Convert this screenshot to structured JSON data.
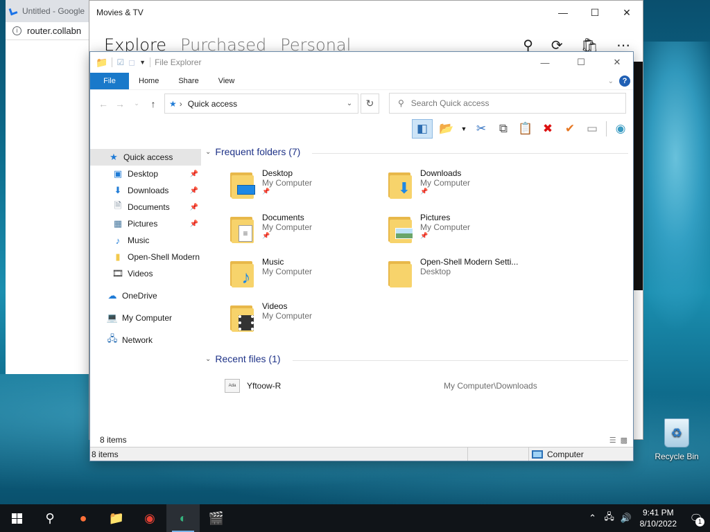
{
  "browser": {
    "tab_title": "Untitled - Google",
    "address": "router.collabn"
  },
  "movies_app": {
    "title": "Movies & TV",
    "nav": [
      "Explore",
      "Purchased",
      "Personal"
    ]
  },
  "explorer": {
    "title": "File Explorer",
    "ribbon_tabs": [
      "File",
      "Home",
      "Share",
      "View"
    ],
    "address": "Quick access",
    "search_placeholder": "Search Quick access",
    "nav_pane": {
      "quick_access": "Quick access",
      "pinned": [
        "Desktop",
        "Downloads",
        "Documents",
        "Pictures"
      ],
      "others": [
        "Music",
        "Open-Shell Modern",
        "Videos"
      ],
      "onedrive": "OneDrive",
      "my_computer": "My Computer",
      "network": "Network"
    },
    "frequent_header": "Frequent folders (7)",
    "frequent_folders": [
      {
        "name": "Desktop",
        "location": "My Computer",
        "pinned": true,
        "icon": "desktop-overlay"
      },
      {
        "name": "Downloads",
        "location": "My Computer",
        "pinned": true,
        "icon": "download-arrow"
      },
      {
        "name": "Documents",
        "location": "My Computer",
        "pinned": true,
        "icon": "document-overlay"
      },
      {
        "name": "Pictures",
        "location": "My Computer",
        "pinned": true,
        "icon": "picture-overlay"
      },
      {
        "name": "Music",
        "location": "My Computer",
        "pinned": false,
        "icon": "music-note"
      },
      {
        "name": "Open-Shell Modern Setti...",
        "location": "Desktop",
        "pinned": false,
        "icon": "plain-folder"
      },
      {
        "name": "Videos",
        "location": "My Computer",
        "pinned": false,
        "icon": "film-strip"
      }
    ],
    "recent_header": "Recent files (1)",
    "recent_files": [
      {
        "name": "Yftoow-R",
        "path": "My Computer\\Downloads",
        "icon_text": "Ada"
      }
    ],
    "status_items": "8 items",
    "bottom_items": "8 items",
    "bottom_location": "Computer"
  },
  "desktop": {
    "recycle_bin": "Recycle Bin"
  },
  "taskbar": {
    "time": "9:41 PM",
    "date": "8/10/2022",
    "notification_count": "1"
  }
}
